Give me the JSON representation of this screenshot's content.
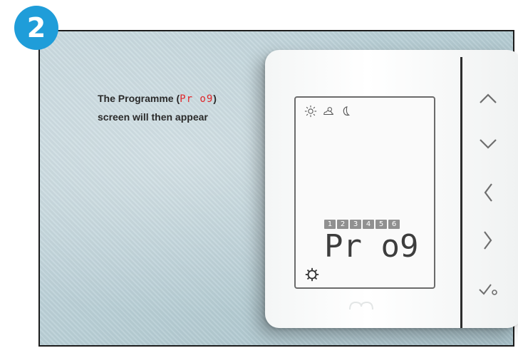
{
  "step": {
    "number": "2"
  },
  "caption": {
    "line1_prefix": "The Programme (",
    "line1_code": "Pr o9",
    "line1_suffix": ")",
    "line2": "screen will then appear"
  },
  "lcd": {
    "weather_icons": [
      "sun-icon",
      "partly-cloudy-icon",
      "moon-icon"
    ],
    "day_numbers": [
      "1",
      "2",
      "3",
      "4",
      "5",
      "6"
    ],
    "program_text": "Pr o9",
    "settings_icon": "gear-icon"
  },
  "buttons": [
    "up-button",
    "down-button",
    "left-button",
    "right-button",
    "confirm-button"
  ],
  "colors": {
    "step_badge": "#1f9dd9",
    "caption_code": "#e0262a"
  }
}
